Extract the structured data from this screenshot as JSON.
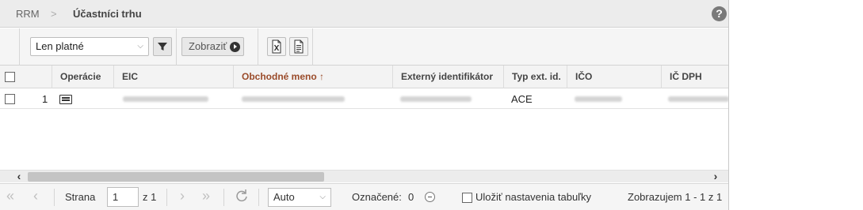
{
  "breadcrumb": {
    "root": "RRM",
    "separator": ">",
    "current": "Účastníci trhu",
    "help": "?"
  },
  "toolbar": {
    "filter_select": "Len platné",
    "show_button": "Zobraziť"
  },
  "table": {
    "columns": [
      {
        "label": "Operácie"
      },
      {
        "label": "EIC"
      },
      {
        "label": "Obchodné meno ↑",
        "sorted": true,
        "sort_direction": "ascending"
      },
      {
        "label": "Externý identifikátor"
      },
      {
        "label": "Typ ext. id."
      },
      {
        "label": "IČO"
      },
      {
        "label": "IČ DPH"
      }
    ],
    "rows": [
      {
        "index": "1",
        "operations_icon": "list-icon",
        "eic": "",
        "name": "",
        "ext_id": "",
        "ext_type": "ACE",
        "ico": "",
        "dic": ""
      }
    ]
  },
  "pager": {
    "page_label": "Strana",
    "page_value": "1",
    "of_label": "z 1",
    "page_size": "Auto",
    "selected_label": "Označené:",
    "selected_count": "0",
    "save_settings_label": "Uložiť nastavenia tabuľky",
    "summary": "Zobrazujem 1 - 1 z 1"
  },
  "colors": {
    "accent_sorted": "#9a4b2a",
    "header_bg": "#ececec"
  }
}
